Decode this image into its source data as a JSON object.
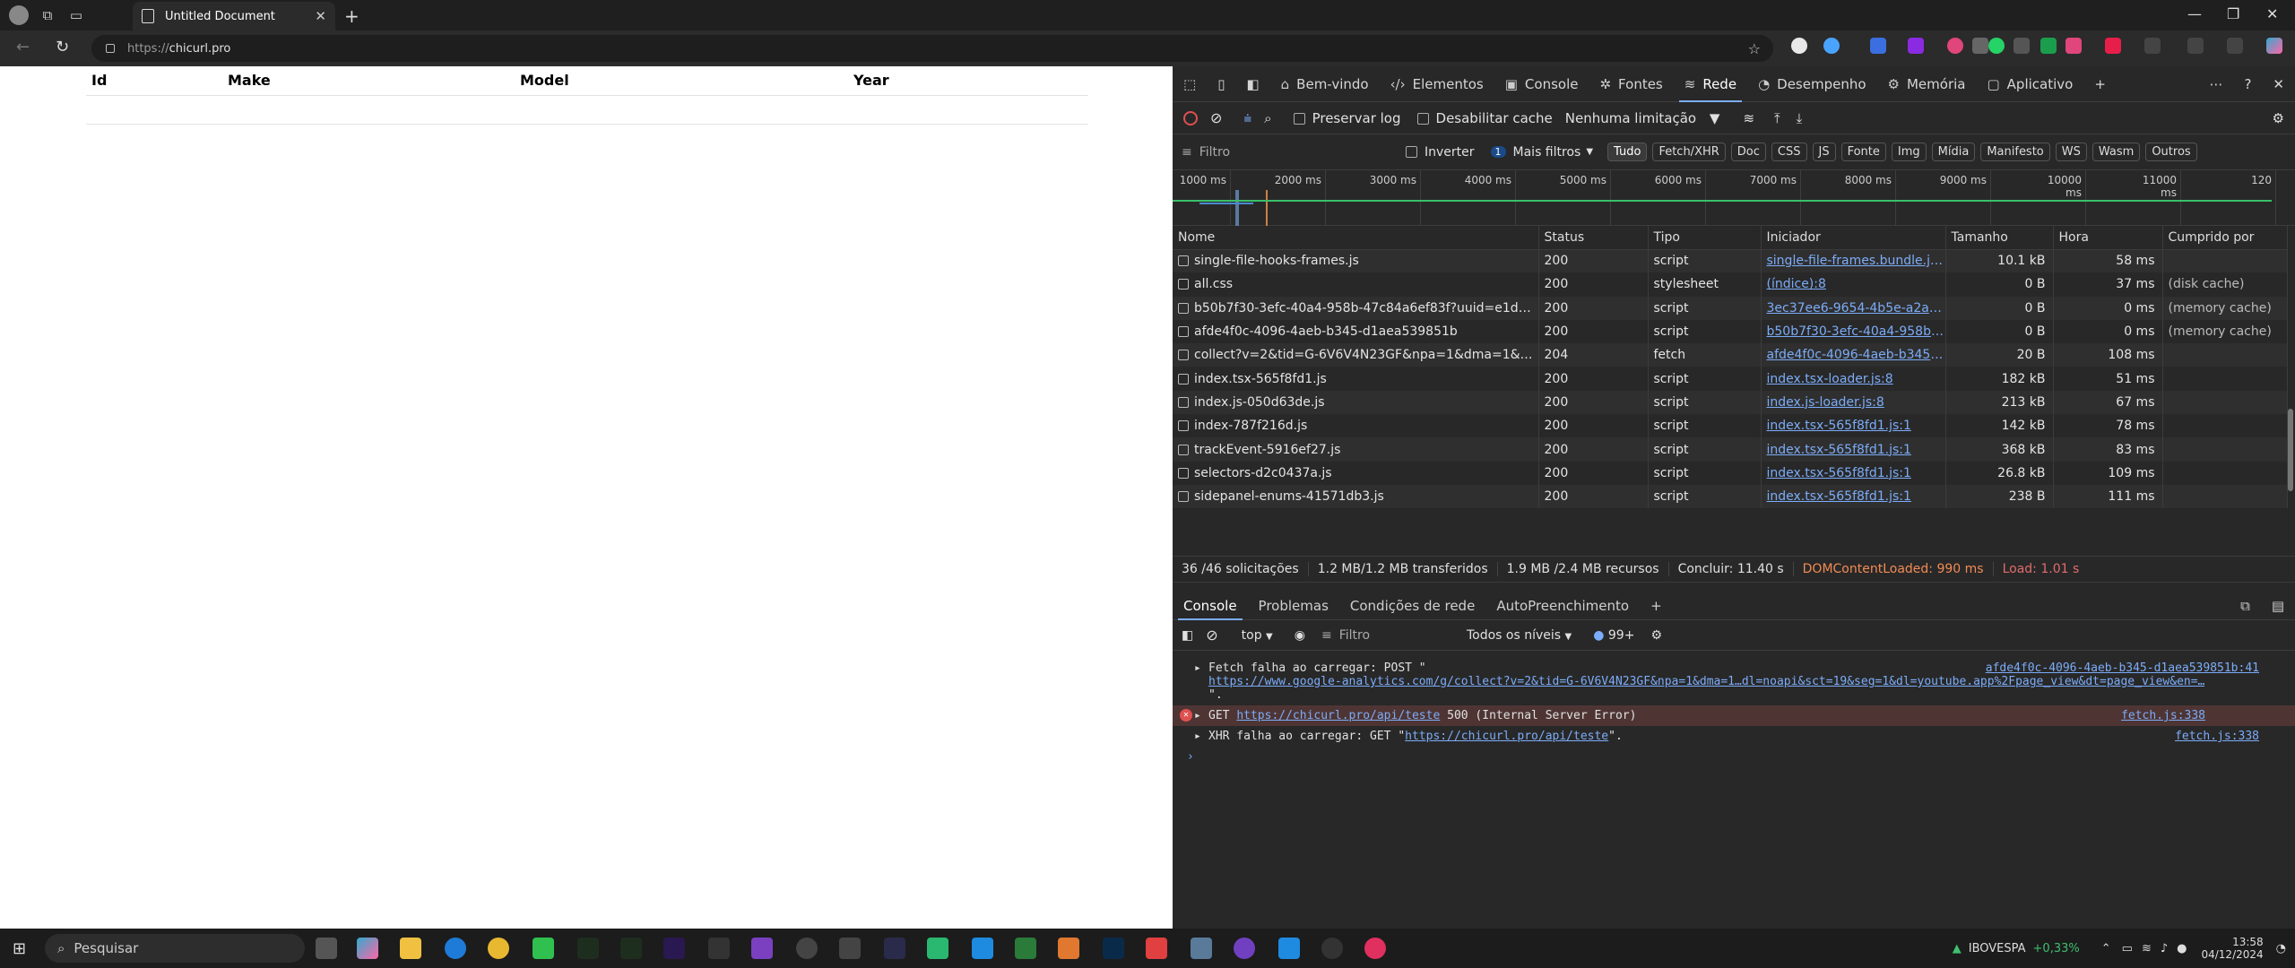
{
  "browser": {
    "tab_title": "Untitled Document",
    "url_prefix": "https://",
    "url_domain": "chicurl.pro"
  },
  "page": {
    "table_headers": [
      "Id",
      "Make",
      "Model",
      "Year"
    ]
  },
  "devtools": {
    "tabs": [
      {
        "label": "Bem-vindo",
        "icon": "home-icon"
      },
      {
        "label": "Elementos",
        "icon": "code-icon"
      },
      {
        "label": "Console",
        "icon": "console-icon"
      },
      {
        "label": "Fontes",
        "icon": "bug-icon"
      },
      {
        "label": "Rede",
        "icon": "wifi-icon"
      },
      {
        "label": "Desempenho",
        "icon": "gauge-icon"
      },
      {
        "label": "Memória",
        "icon": "gear-icon"
      },
      {
        "label": "Aplicativo",
        "icon": "app-icon"
      }
    ],
    "network_toolbar": {
      "preserve_log": "Preservar log",
      "disable_cache": "Desabilitar cache",
      "throttle": "Nenhuma limitação"
    },
    "filter": {
      "placeholder": "Filtro",
      "invert": "Inverter",
      "more_filters_count": "1",
      "more_filters": "Mais filtros",
      "types": [
        "Tudo",
        "Fetch/XHR",
        "Doc",
        "CSS",
        "JS",
        "Fonte",
        "Img",
        "Mídia",
        "Manifesto",
        "WS",
        "Wasm",
        "Outros"
      ]
    },
    "timeline_ticks": [
      "1000 ms",
      "2000 ms",
      "3000 ms",
      "4000 ms",
      "5000 ms",
      "6000 ms",
      "7000 ms",
      "8000 ms",
      "9000 ms",
      "10000 ms",
      "11000 ms",
      "120"
    ],
    "columns": [
      "Nome",
      "Status",
      "Tipo",
      "Iniciador",
      "Tamanho",
      "Hora",
      "Cumprido por"
    ],
    "requests": [
      {
        "name": "single-file-hooks-frames.js",
        "status": "200",
        "type": "script",
        "initiator": "single-file-frames.bundle.js:3",
        "size": "10.1 kB",
        "time": "58 ms",
        "fulfilled": ""
      },
      {
        "name": "all.css",
        "status": "200",
        "type": "stylesheet",
        "initiator": "(índice):8",
        "size": "0 B",
        "time": "37 ms",
        "fulfilled": "(disk cache)"
      },
      {
        "name": "b50b7f30-3efc-40a4-958b-47c84a6ef83f?uuid=e1d402...",
        "status": "200",
        "type": "script",
        "initiator": "3ec37ee6-9654-4b5e-a2aa-86",
        "size": "0 B",
        "time": "0 ms",
        "fulfilled": "(memory cache)"
      },
      {
        "name": "afde4f0c-4096-4aeb-b345-d1aea539851b",
        "status": "200",
        "type": "script",
        "initiator": "b50b7f30-3efc-40a4-958b-47c",
        "size": "0 B",
        "time": "0 ms",
        "fulfilled": "(memory cache)"
      },
      {
        "name": "collect?v=2&tid=G-6V6V4N23GF&npa=1&dma=1&ci...",
        "status": "204",
        "type": "fetch",
        "initiator": "afde4f0c-4096-4aeb-b345-d1a",
        "size": "20 B",
        "time": "108 ms",
        "fulfilled": ""
      },
      {
        "name": "index.tsx-565f8fd1.js",
        "status": "200",
        "type": "script",
        "initiator": "index.tsx-loader.js:8",
        "size": "182 kB",
        "time": "51 ms",
        "fulfilled": ""
      },
      {
        "name": "index.js-050d63de.js",
        "status": "200",
        "type": "script",
        "initiator": "index.js-loader.js:8",
        "size": "213 kB",
        "time": "67 ms",
        "fulfilled": ""
      },
      {
        "name": "index-787f216d.js",
        "status": "200",
        "type": "script",
        "initiator": "index.tsx-565f8fd1.js:1",
        "size": "142 kB",
        "time": "78 ms",
        "fulfilled": ""
      },
      {
        "name": "trackEvent-5916ef27.js",
        "status": "200",
        "type": "script",
        "initiator": "index.tsx-565f8fd1.js:1",
        "size": "368 kB",
        "time": "83 ms",
        "fulfilled": ""
      },
      {
        "name": "selectors-d2c0437a.js",
        "status": "200",
        "type": "script",
        "initiator": "index.tsx-565f8fd1.js:1",
        "size": "26.8 kB",
        "time": "109 ms",
        "fulfilled": ""
      },
      {
        "name": "sidepanel-enums-41571db3.js",
        "status": "200",
        "type": "script",
        "initiator": "index.tsx-565f8fd1.js:1",
        "size": "238 B",
        "time": "111 ms",
        "fulfilled": ""
      }
    ],
    "summary": {
      "requests": "36 /46 solicitações",
      "transferred": "1.2 MB/1.2 MB transferidos",
      "resources": "1.9 MB /2.4 MB recursos",
      "finish": "Concluir: 11.40 s",
      "dcl": "DOMContentLoaded: 990 ms",
      "load": "Load: 1.01 s"
    },
    "drawer_tabs": [
      "Console",
      "Problemas",
      "Condições de rede",
      "AutoPreenchimento"
    ],
    "console_toolbar": {
      "context": "top",
      "filter_placeholder": "Filtro",
      "levels": "Todos os níveis",
      "issues": "99+"
    },
    "console": {
      "msg1_text": "Fetch falha ao carregar: POST \"",
      "msg1_url": "https://www.google-analytics.com/g/collect?v=2&tid=G-6V6V4N23GF&npa=1&dma=1…dl=noapi&sct=19&seg=1&dl=youtube.app%2Fpage_view&dt=page_view&en=…",
      "msg1_end": "\".",
      "msg1_src": "afde4f0c-4096-4aeb-b345-d1aea539851b:41",
      "msg2_prefix": "GET",
      "msg2_url": "https://chicurl.pro/api/teste",
      "msg2_text": "500 (Internal Server Error)",
      "msg2_src": "fetch.js:338",
      "msg3_text": "XHR falha ao carregar: GET \"",
      "msg3_url": "https://chicurl.pro/api/teste",
      "msg3_end": "\".",
      "msg3_src": "fetch.js:338"
    }
  },
  "taskbar": {
    "search_placeholder": "Pesquisar",
    "ticker_name": "IBOVESPA",
    "ticker_change": "+0,33%",
    "time": "13:58",
    "date": "04/12/2024"
  },
  "colors": {
    "accent": "#7cacf8",
    "error_bg": "#4e3534",
    "dcl": "#f28b54",
    "load": "#e06c6c",
    "ticker_up": "#3fbf6f"
  }
}
